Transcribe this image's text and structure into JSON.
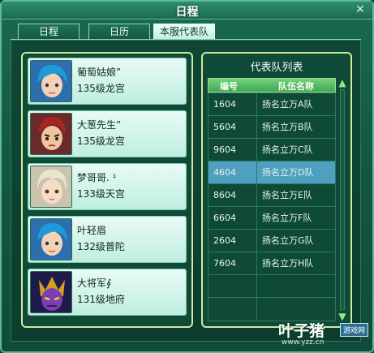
{
  "window": {
    "title": "日程",
    "close_glyph": "✕"
  },
  "tabs": [
    {
      "label": "日程",
      "active": false
    },
    {
      "label": "日历",
      "active": false
    },
    {
      "label": "本服代表队",
      "active": true
    }
  ],
  "members": [
    {
      "name": "葡萄姑娘”",
      "level": "135级龙宫",
      "avatar": "girl-blue-hair-avatar"
    },
    {
      "name": "大葱先生”",
      "level": "135级龙宫",
      "avatar": "man-red-hair-avatar"
    },
    {
      "name": "梦哥哥. ¹",
      "level": "133级天宫",
      "avatar": "boy-light-hair-avatar"
    },
    {
      "name": "叶轻眉",
      "level": "132级普陀",
      "avatar": "girl-blue-hair-avatar"
    },
    {
      "name": "大将军∮",
      "level": "131级地府",
      "avatar": "demon-purple-avatar"
    }
  ],
  "teams": {
    "title": "代表队列表",
    "headers": {
      "id": "编号",
      "name": "队伍名称"
    },
    "rows": [
      {
        "id": "1604",
        "name": "扬名立万A队",
        "selected": false
      },
      {
        "id": "5604",
        "name": "扬名立万B队",
        "selected": false
      },
      {
        "id": "9604",
        "name": "扬名立万C队",
        "selected": false
      },
      {
        "id": "4604",
        "name": "扬名立万D队",
        "selected": true
      },
      {
        "id": "8604",
        "name": "扬名立万E队",
        "selected": false
      },
      {
        "id": "6604",
        "name": "扬名立万F队",
        "selected": false
      },
      {
        "id": "2604",
        "name": "扬名立万G队",
        "selected": false
      },
      {
        "id": "7604",
        "name": "扬名立万H队",
        "selected": false
      }
    ]
  },
  "watermark": {
    "brand": "叶子猪",
    "tag": "游戏网",
    "url": "www.yzz.cn"
  },
  "colors": {
    "selected_row": "#4f9fc0",
    "header_green": "#3fa556",
    "frame": "#cfe9a0"
  }
}
